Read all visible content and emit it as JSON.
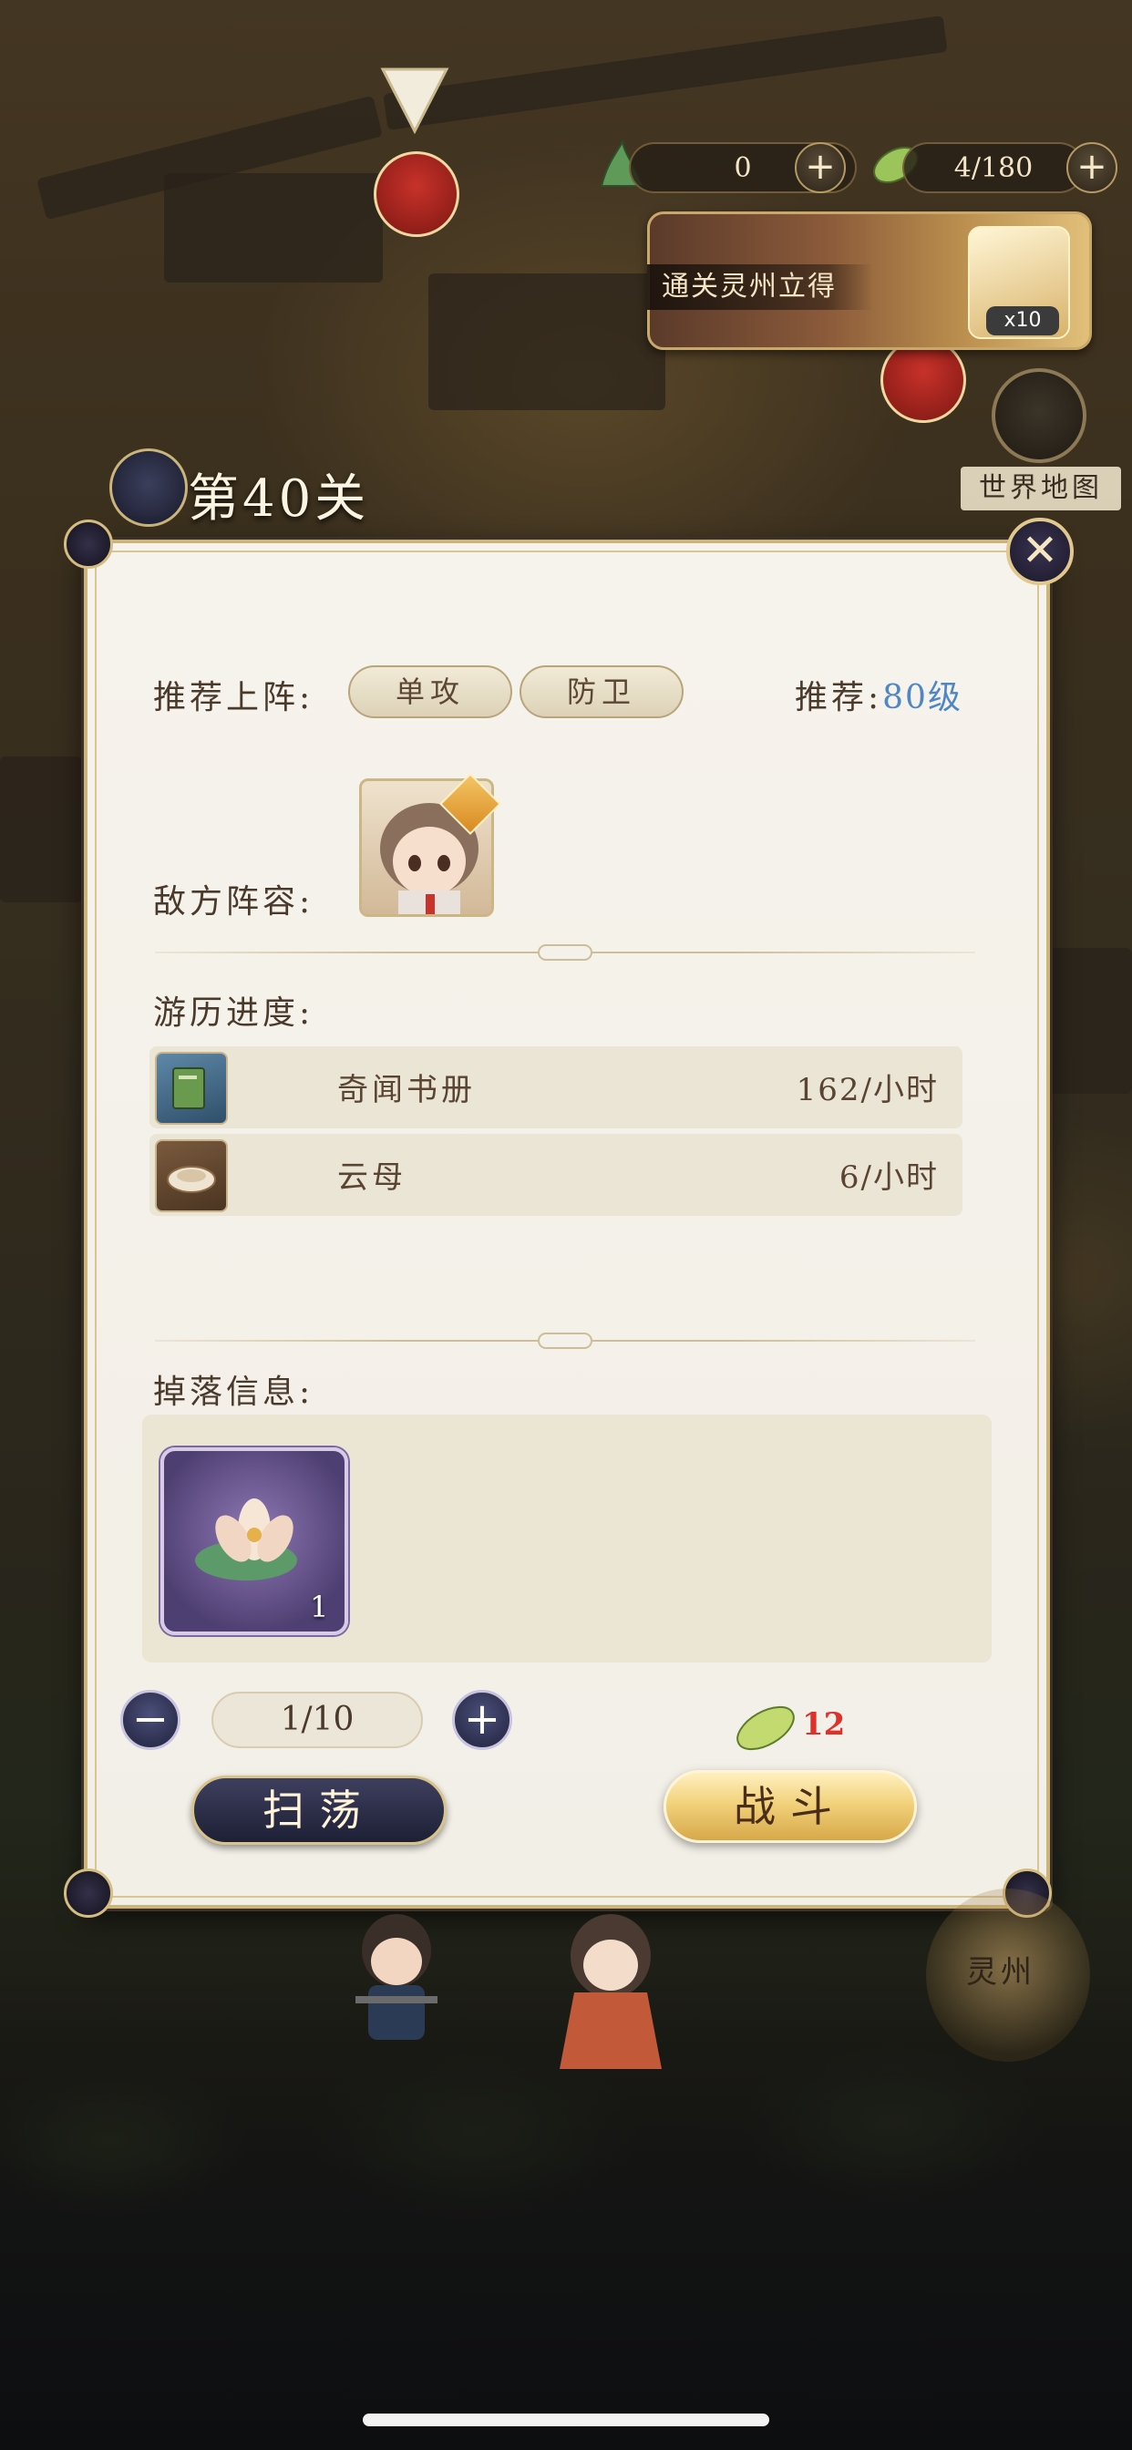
{
  "hud": {
    "currency_left": "0",
    "stamina": "4/180",
    "quest_banner_text": "通关灵州立得",
    "quest_reward_count": "x10",
    "world_map_label": "世界地图"
  },
  "stage": {
    "title": "第40关"
  },
  "panel": {
    "recommend_label": "推荐上阵:",
    "tags": [
      "单攻",
      "防卫"
    ],
    "recommend_level_label": "推荐:",
    "recommend_level_value": "80级",
    "enemy_label": "敌方阵容:",
    "progress_label": "游历进度:",
    "progress_items": [
      {
        "name": "奇闻书册",
        "rate": "162/小时",
        "icon": "book-icon"
      },
      {
        "name": "云母",
        "rate": "6/小时",
        "icon": "mica-icon"
      }
    ],
    "drops_label": "掉落信息:",
    "drop_item": {
      "icon": "lotus-icon",
      "count": "1"
    },
    "counter_value": "1/10",
    "cost_value": "12",
    "sweep_label": "扫荡",
    "battle_label": "战斗"
  },
  "region": {
    "label": "灵州"
  },
  "colors": {
    "accent_gold": "#cdb47a",
    "level_blue": "#4f86c4",
    "cost_red": "#e0302a",
    "panel_bg": "#f4f1ea"
  }
}
